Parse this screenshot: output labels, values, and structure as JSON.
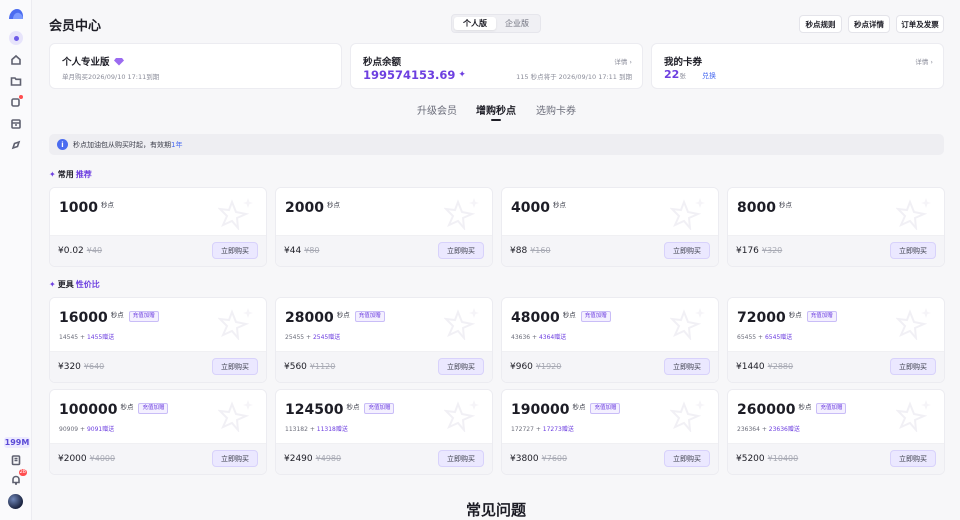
{
  "sidebar": {
    "balance_badge": "199M",
    "notification_count": "28",
    "icons": [
      "logo-icon",
      "user-icon",
      "home-icon",
      "folder-icon",
      "apps-icon",
      "archive-icon",
      "compass-icon",
      "clipboard-icon",
      "bell-icon"
    ]
  },
  "header": {
    "title": "会员中心",
    "segments": [
      "个人版",
      "企业版"
    ],
    "active_segment": "个人版",
    "buttons": [
      "秒点规则",
      "秒点详情",
      "订单及发票"
    ]
  },
  "summary": {
    "plan": {
      "title": "个人专业版",
      "subtitle": "单月购买2026/09/10 17:11到期"
    },
    "balance": {
      "title": "秒点余额",
      "link": "详情",
      "value": "199574153.69",
      "note": "115 秒点将于 2026/09/10 17:11 到期"
    },
    "coupons": {
      "title": "我的卡券",
      "link": "详情",
      "count": "22",
      "unit": "张",
      "exchange": "兑换"
    }
  },
  "tabs": [
    "升级会员",
    "增购秒点",
    "选购卡券"
  ],
  "active_tab": "增购秒点",
  "banner": {
    "text": "秒点加油包从购买时起，有效期",
    "highlight": "1年"
  },
  "sections": {
    "common": {
      "prefix": "常用",
      "highlight": "推荐"
    },
    "value": {
      "prefix": "更具",
      "highlight": "性价比"
    }
  },
  "unit_label": "秒点",
  "tag_label": "充值加赠",
  "buy_label": "立即购买",
  "bonus_suffix": "赠送",
  "common_products": [
    {
      "amount": "1000",
      "price": "¥0.02",
      "original": "¥40"
    },
    {
      "amount": "2000",
      "price": "¥44",
      "original": "¥80"
    },
    {
      "amount": "4000",
      "price": "¥88",
      "original": "¥160"
    },
    {
      "amount": "8000",
      "price": "¥176",
      "original": "¥320"
    }
  ],
  "value_products": [
    {
      "amount": "16000",
      "base": "14545",
      "bonus": "1455",
      "price": "¥320",
      "original": "¥640"
    },
    {
      "amount": "28000",
      "base": "25455",
      "bonus": "2545",
      "price": "¥560",
      "original": "¥1120"
    },
    {
      "amount": "48000",
      "base": "43636",
      "bonus": "4364",
      "price": "¥960",
      "original": "¥1920"
    },
    {
      "amount": "72000",
      "base": "65455",
      "bonus": "6545",
      "price": "¥1440",
      "original": "¥2880"
    },
    {
      "amount": "100000",
      "base": "90909",
      "bonus": "9091",
      "price": "¥2000",
      "original": "¥4000"
    },
    {
      "amount": "124500",
      "base": "113182",
      "bonus": "11318",
      "price": "¥2490",
      "original": "¥4980"
    },
    {
      "amount": "190000",
      "base": "172727",
      "bonus": "17273",
      "price": "¥3800",
      "original": "¥7600"
    },
    {
      "amount": "260000",
      "base": "236364",
      "bonus": "23636",
      "price": "¥5200",
      "original": "¥10400"
    }
  ],
  "faq_title": "常见问题",
  "colors": {
    "accent": "#6d3fe0",
    "link": "#4b6cf0",
    "badge": "#ff4d4f"
  }
}
